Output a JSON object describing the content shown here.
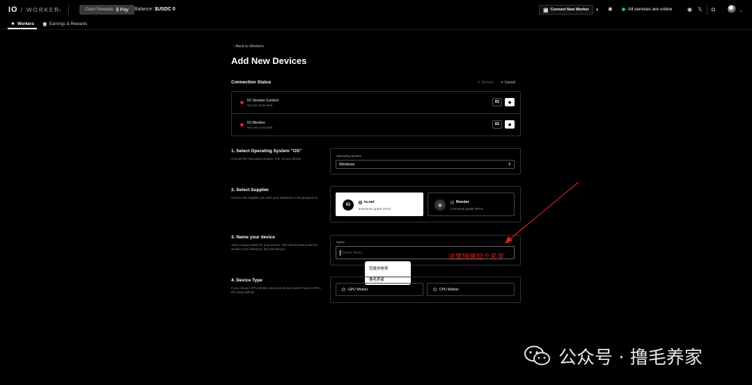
{
  "header": {
    "logo": "IO",
    "product": "/ WORKER",
    "claim_label": "Claim Rewards",
    "pay_label": "Pay",
    "balance_label": "Balance:",
    "balance_value": "$USDC 0",
    "connect_label": "Connect New Worker",
    "status_text": "All services are online"
  },
  "tabs": [
    {
      "label": "Workers",
      "active": true
    },
    {
      "label": "Earnings & Rewards",
      "active": false
    }
  ],
  "page": {
    "back_label": "Back to Workers",
    "title": "Add New Devices"
  },
  "connection": {
    "title": "Connection Status",
    "refresh_label": "Refresh",
    "cancel_label": "Cancel",
    "services": [
      {
        "name": "IO Version Control",
        "status": "Not yet connected"
      },
      {
        "name": "IO Monitor",
        "status": "Not yet connected"
      }
    ]
  },
  "os": {
    "title": "1. Select Operating System \"OS\"",
    "desc": "Choose the Operating System \"OS\" of your device",
    "field_label": "Operating System",
    "value": "Windows"
  },
  "supplier": {
    "title": "2. Select Supplier",
    "desc": "Choose the supplier you wish your hardware to be grouped on",
    "options": [
      {
        "name": "io.net",
        "sub": "Enterprise grade GPUs",
        "selected": true
      },
      {
        "name": "Render",
        "sub": "Consumer grade GPUs",
        "selected": false
      }
    ]
  },
  "name": {
    "title": "3. Name your device",
    "desc": "Add a unique name for your device. The ideal format would be similar to the following: My-Test-Device",
    "field_label": "Name",
    "placeholder": "Device Name",
    "annotation": "这里随便起个名字",
    "suggestions": [
      "空投刘老师",
      "撸毛养家"
    ]
  },
  "device_type": {
    "title": "4. Device Type",
    "desc": "If you choose GPU Worker and your device doesn't have a GPU, the setup will fail",
    "options": [
      "GPU Worker",
      "CPU Worker"
    ]
  },
  "watermark": {
    "text": "公众号 · 撸毛养家"
  },
  "colors": {
    "accent_red": "#e11d2e",
    "status_green": "#22c55e",
    "annotation_red": "#e11d1d"
  }
}
